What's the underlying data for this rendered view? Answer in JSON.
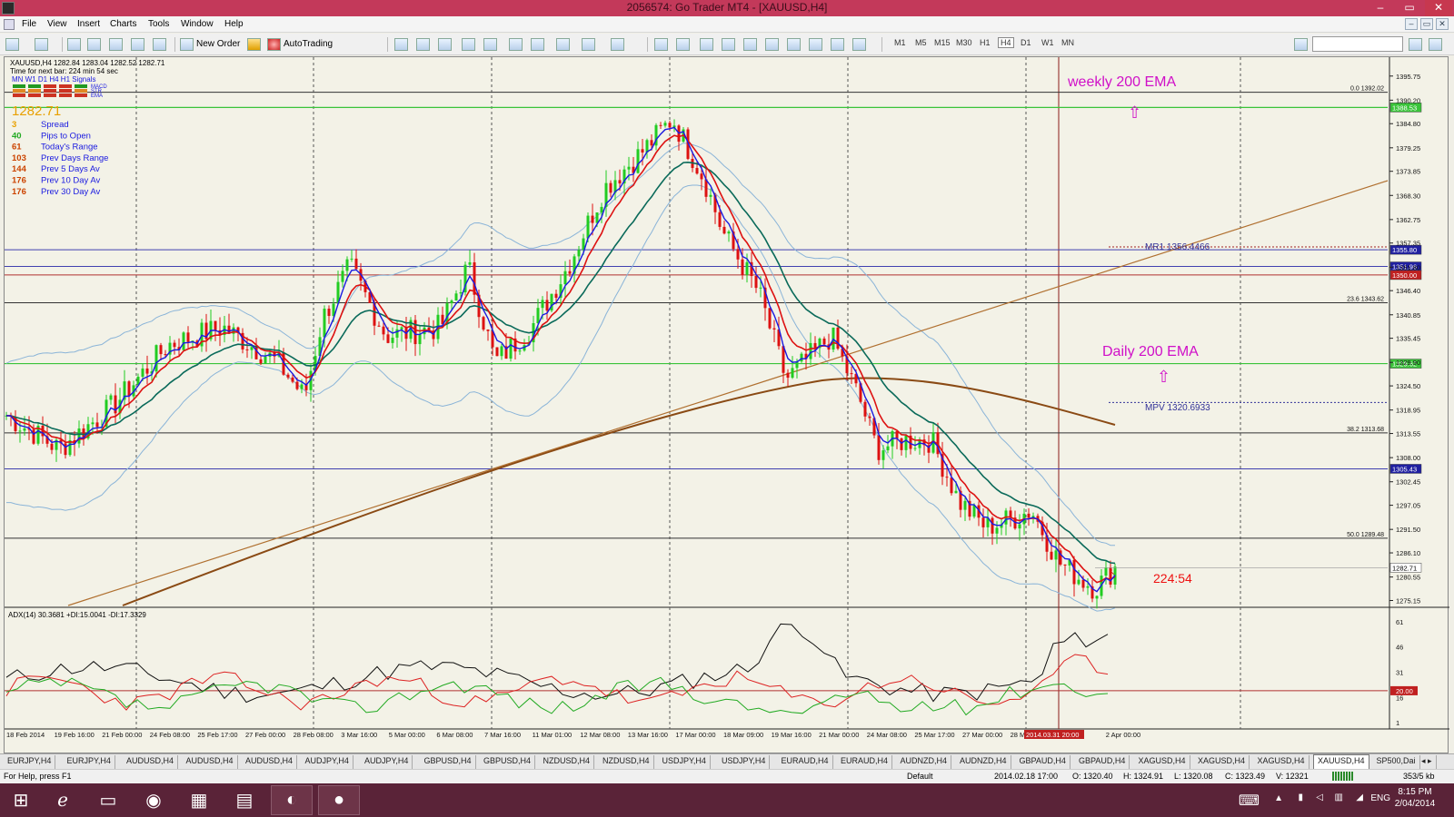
{
  "window": {
    "title": "2056574: Go Trader MT4 - [XAUUSD,H4]",
    "min": "–",
    "max": "▭",
    "close": "✕"
  },
  "menu": [
    "File",
    "View",
    "Insert",
    "Charts",
    "Tools",
    "Window",
    "Help"
  ],
  "toolbar": {
    "new_order": "New Order",
    "autotrading": "AutoTrading",
    "timeframes": [
      "M1",
      "M5",
      "M15",
      "M30",
      "H1",
      "H4",
      "D1",
      "W1",
      "MN"
    ],
    "active_timeframe": "H4"
  },
  "chart": {
    "header": "XAUUSD,H4  1282.84 1283.04 1282.52 1282.71",
    "next_bar": "Time for next bar: 224 min 54 sec",
    "signal_tfs": "MN  W1  D1  H4  H1   Signals",
    "signal_rows": [
      "MACD",
      "STR",
      "EMA"
    ],
    "price": "1282.71",
    "stats": [
      {
        "val": "3",
        "label": "Spread",
        "color": "#e8a000"
      },
      {
        "val": "40",
        "label": "Pips to Open",
        "color": "#22aa22"
      },
      {
        "val": "61",
        "label": "Today's Range",
        "color": "#cc4400"
      },
      {
        "val": "103",
        "label": "Prev Days Range",
        "color": "#cc4400"
      },
      {
        "val": "144",
        "label": "Prev 5 Days Av",
        "color": "#cc4400"
      },
      {
        "val": "176",
        "label": "Prev 10 Day Av",
        "color": "#cc4400"
      },
      {
        "val": "176",
        "label": "Prev 30 Day Av",
        "color": "#cc4400"
      }
    ],
    "annotations": {
      "weekly": "weekly 200 EMA",
      "daily": "Daily 200 EMA",
      "countdown": "224:54",
      "mr1": "MR1   1356.4466",
      "mpv": "MPV   1320.6933"
    },
    "fib": [
      {
        "label": "0.0 1392.02"
      },
      {
        "label": "23.6 1343.62"
      },
      {
        "label": "38.2 1313.68"
      },
      {
        "label": "50.0 1289.48"
      }
    ],
    "price_ticks": [
      "1395.75",
      "1390.20",
      "1384.80",
      "1379.25",
      "1373.85",
      "1368.30",
      "1362.75",
      "1357.35",
      "1351.80",
      "1346.40",
      "1340.85",
      "1335.45",
      "1329.90",
      "1324.50",
      "1318.95",
      "1313.55",
      "1308.00",
      "1302.45",
      "1297.05",
      "1291.50",
      "1286.10",
      "1280.55",
      "1275.15"
    ],
    "price_boxes": [
      "1388.53",
      "1355.80",
      "1351.96",
      "1350.00",
      "1329.62",
      "1305.43",
      "1282.71"
    ],
    "adx_header": "ADX(14) 30.3681 +DI:15.0041 -DI:17.3329",
    "adx_ticks": [
      "61",
      "46",
      "31",
      "20.00",
      "16",
      "1"
    ],
    "time_labels": [
      "18 Feb 2014",
      "19 Feb 16:00",
      "21 Feb 00:00",
      "24 Feb 08:00",
      "25 Feb 17:00",
      "27 Feb 00:00",
      "28 Feb 08:00",
      "3 Mar 16:00",
      "5 Mar 00:00",
      "6 Mar 08:00",
      "7 Mar 16:00",
      "11 Mar 01:00",
      "12 Mar 08:00",
      "13 Mar 16:00",
      "17 Mar 00:00",
      "18 Mar 09:00",
      "19 Mar 16:00",
      "21 Mar 00:00",
      "24 Mar 08:00",
      "25 Mar 17:00",
      "27 Mar 00:00",
      "28 Mar",
      "2014.03.31 20:00",
      "2 Apr 00:00"
    ]
  },
  "tabs": [
    "EURJPY,H4",
    "EURJPY,H4",
    "AUDUSD,H4",
    "AUDUSD,H4",
    "AUDUSD,H4",
    "AUDJPY,H4",
    "AUDJPY,H4",
    "GBPUSD,H4",
    "GBPUSD,H4",
    "NZDUSD,H4",
    "NZDUSD,H4",
    "USDJPY,H4",
    "USDJPY,H4",
    "EURAUD,H4",
    "EURAUD,H4",
    "AUDNZD,H4",
    "AUDNZD,H4",
    "GBPAUD,H4",
    "GBPAUD,H4",
    "XAGUSD,H4",
    "XAGUSD,H4",
    "XAGUSD,H4",
    "XAUUSD,H4",
    "SP500,Dai"
  ],
  "active_tab": 22,
  "status": {
    "help": "For Help, press F1",
    "profile": "Default",
    "time": "2014.02.18 17:00",
    "open": "O: 1320.40",
    "high": "H: 1324.91",
    "low": "L: 1320.08",
    "close": "C: 1323.49",
    "volume": "V: 12321",
    "traffic": "353/5 kb"
  },
  "tray": {
    "lang": "ENG",
    "time": "8:15 PM",
    "date": "2/04/2014"
  },
  "colors": {
    "title": "#c3395a",
    "taskbar": "#5a2338",
    "up": "#22cc22",
    "down": "#dd1111",
    "ema_fast": "#1a1ae0",
    "ema_mid": "#dd1111",
    "ema_slow": "#0a6a5a",
    "band": "#8ab4d8",
    "ema200": "#8a4a14",
    "annot": "#d010c8"
  }
}
